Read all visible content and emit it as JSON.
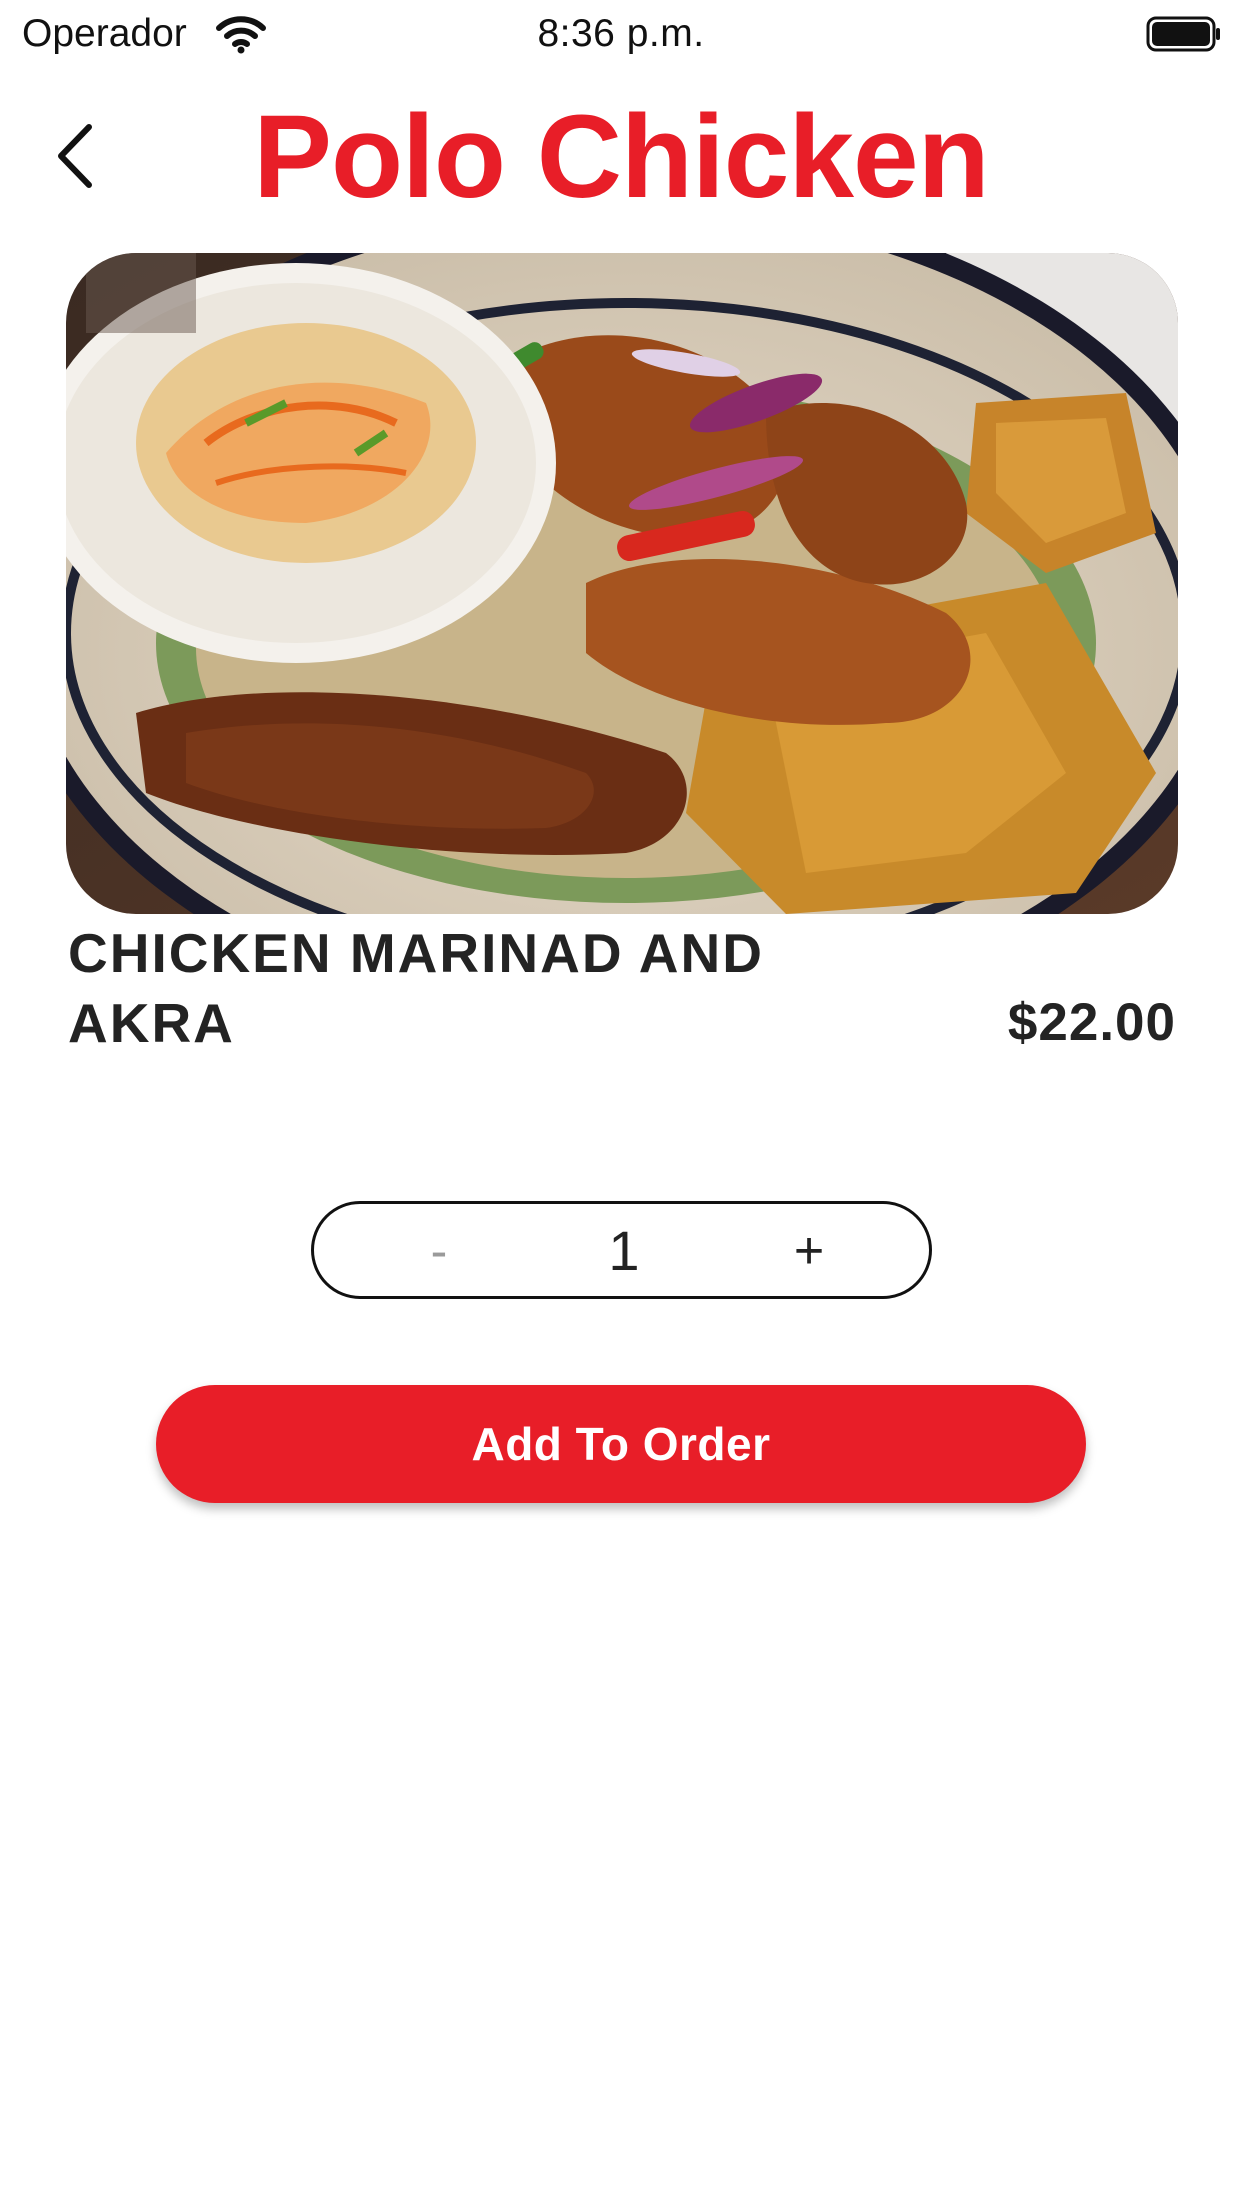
{
  "status_bar": {
    "carrier": "Operador",
    "time": "8:36 p.m.",
    "wifi_icon": "wifi-icon",
    "battery_icon": "battery-icon"
  },
  "header": {
    "back_icon": "chevron-left-icon",
    "title": "Polo Chicken",
    "title_color": "#e81e28"
  },
  "item": {
    "image_alt": "food-photo",
    "name": "CHICKEN MARINAD AND AKRA",
    "price": "$22.00"
  },
  "stepper": {
    "minus_label": "-",
    "quantity": "1",
    "plus_label": "+"
  },
  "actions": {
    "add_to_order_label": "Add To Order",
    "accent_color": "#e81e28"
  }
}
